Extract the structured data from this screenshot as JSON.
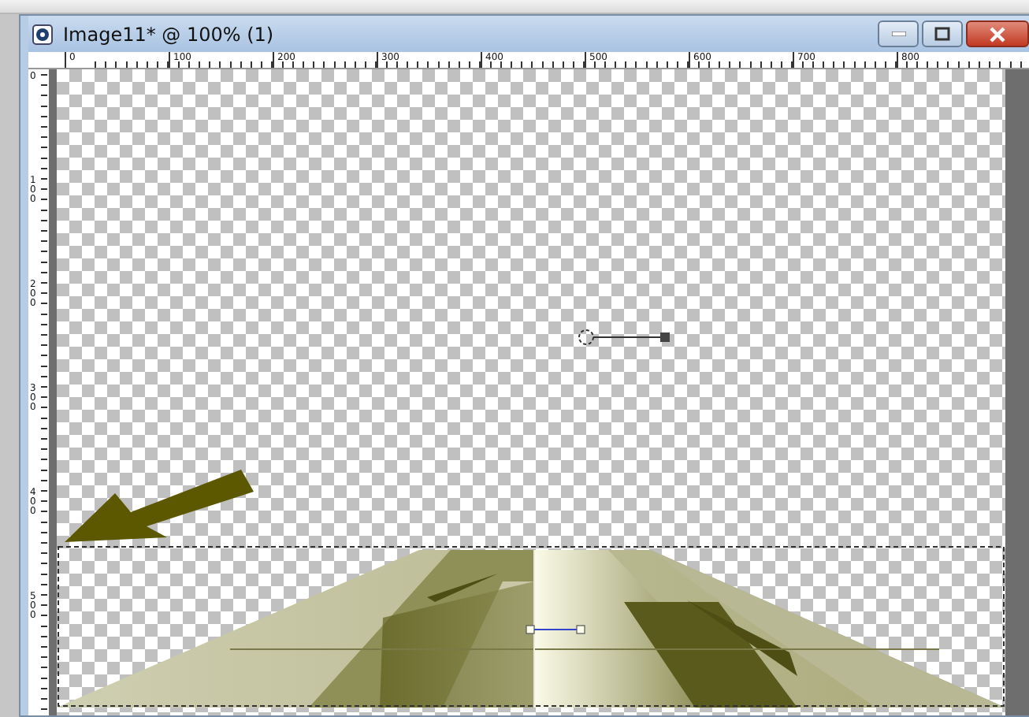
{
  "window": {
    "title": "Image11* @ 100% (1)"
  },
  "ruler_top": {
    "labels": [
      "0",
      "100",
      "200",
      "300",
      "400",
      "500",
      "600",
      "700",
      "800"
    ]
  },
  "ruler_left": {
    "labels": [
      "0",
      "100",
      "200",
      "300",
      "400",
      "500"
    ]
  }
}
